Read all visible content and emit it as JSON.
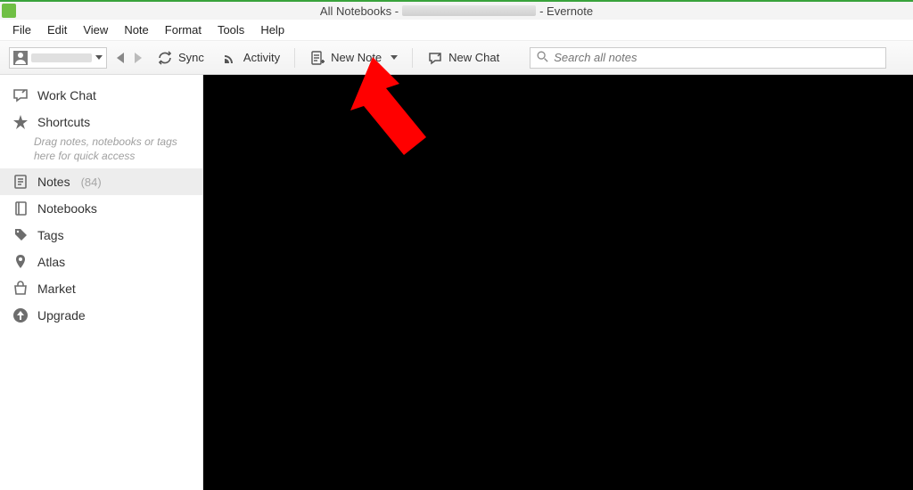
{
  "title": {
    "prefix": "All Notebooks -",
    "suffix": "- Evernote"
  },
  "menubar": [
    "File",
    "Edit",
    "View",
    "Note",
    "Format",
    "Tools",
    "Help"
  ],
  "toolbar": {
    "sync_label": "Sync",
    "activity_label": "Activity",
    "new_note_label": "New Note",
    "new_chat_label": "New Chat"
  },
  "search": {
    "placeholder": "Search all notes"
  },
  "sidebar": {
    "work_chat_label": "Work Chat",
    "shortcuts_label": "Shortcuts",
    "shortcuts_hint": "Drag notes, notebooks or tags here for quick access",
    "notes_label": "Notes",
    "notes_count": "(84)",
    "notebooks_label": "Notebooks",
    "tags_label": "Tags",
    "atlas_label": "Atlas",
    "market_label": "Market",
    "upgrade_label": "Upgrade"
  }
}
